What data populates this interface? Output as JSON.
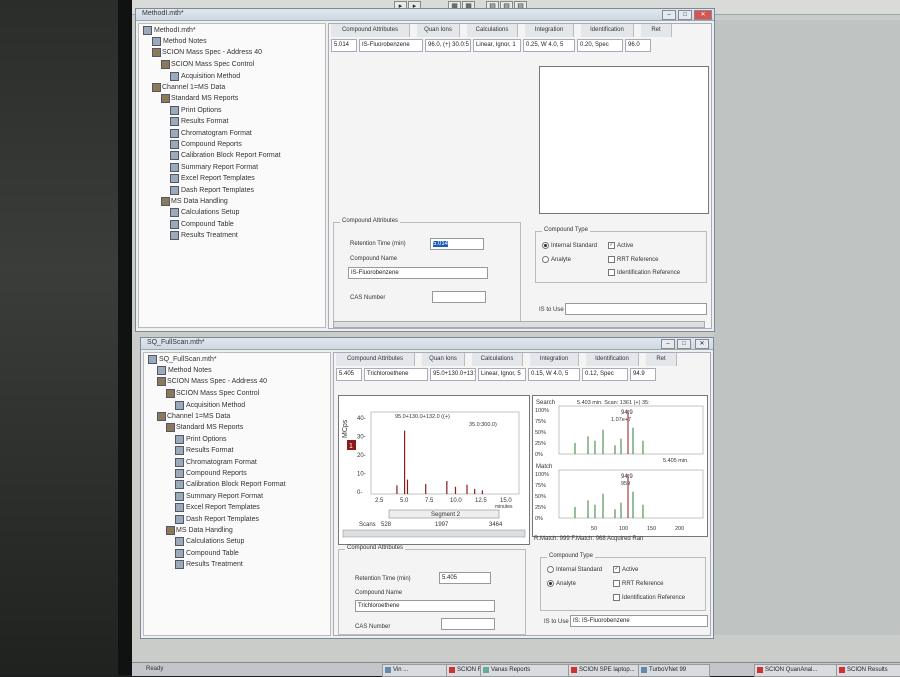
{
  "colors": {
    "accent": "#1a5fb4",
    "close": "#d9534f",
    "series_red": "#8b1a1a",
    "series_green": "#2e7d32"
  },
  "window1": {
    "title": "MethodI.mth*",
    "tree": [
      {
        "label": "MethodI.mth*",
        "level": 0,
        "exp": "",
        "icon": "doc"
      },
      {
        "label": "Method Notes",
        "level": 1,
        "exp": "",
        "icon": "doc"
      },
      {
        "label": "SCION Mass Spec - Address 40",
        "level": 1,
        "exp": "⊟",
        "icon": "grp"
      },
      {
        "label": "SCION Mass Spec Control",
        "level": 2,
        "exp": "⊟",
        "icon": "grp"
      },
      {
        "label": "Acquisition Method",
        "level": 3,
        "exp": "",
        "icon": "doc"
      },
      {
        "label": "Channel 1=MS Data",
        "level": 1,
        "exp": "⊟",
        "icon": "grp"
      },
      {
        "label": "Standard MS Reports",
        "level": 2,
        "exp": "⊟",
        "icon": "grp"
      },
      {
        "label": "Print Options",
        "level": 3,
        "exp": "",
        "icon": "doc"
      },
      {
        "label": "Results Format",
        "level": 3,
        "exp": "",
        "icon": "doc"
      },
      {
        "label": "Chromatogram Format",
        "level": 3,
        "exp": "",
        "icon": "doc"
      },
      {
        "label": "Compound Reports",
        "level": 3,
        "exp": "",
        "icon": "doc"
      },
      {
        "label": "Calibration Block Report Format",
        "level": 3,
        "exp": "",
        "icon": "doc"
      },
      {
        "label": "Summary Report Format",
        "level": 3,
        "exp": "",
        "icon": "doc"
      },
      {
        "label": "Excel Report Templates",
        "level": 3,
        "exp": "",
        "icon": "doc"
      },
      {
        "label": "Dash Report Templates",
        "level": 3,
        "exp": "",
        "icon": "doc"
      },
      {
        "label": "MS Data Handling",
        "level": 2,
        "exp": "⊟",
        "icon": "grp"
      },
      {
        "label": "Calculations Setup",
        "level": 3,
        "exp": "",
        "icon": "doc"
      },
      {
        "label": "Compound Table",
        "level": 3,
        "exp": "",
        "icon": "doc"
      },
      {
        "label": "Results Treatment",
        "level": 3,
        "exp": "",
        "icon": "doc"
      }
    ],
    "tabs": [
      "Compound Attributes",
      "Quan Ions",
      "Calculations",
      "Integration",
      "Identification",
      "Ret"
    ],
    "row": [
      "5.014",
      "IS-Fluorobenzene",
      "96.0, (+) 30.0:5",
      "Linear, Ignor, 1",
      "0.25, W 4.0, 5",
      "0.20, Spec",
      "96.0"
    ],
    "attributes": {
      "group_title": "Compound Attributes",
      "retention_label": "Retention Time (min)",
      "retention_value": "5.014",
      "name_label": "Compound Name",
      "name_value": "IS-Fluorobenzene",
      "cas_label": "CAS Number",
      "cas_value": ""
    },
    "compound_type": {
      "title": "Compound Type",
      "internal_standard": "Internal Standard",
      "analyte": "Analyte",
      "active": "Active",
      "rrt": "RRT Reference",
      "identification": "Identification Reference",
      "is_to_use": "IS to Use",
      "is_value": ""
    }
  },
  "window2": {
    "title": "SQ_FullScan.mth*",
    "tree": [
      {
        "label": "SQ_FullScan.mth*",
        "level": 0,
        "exp": "",
        "icon": "doc"
      },
      {
        "label": "Method Notes",
        "level": 1,
        "exp": "",
        "icon": "doc"
      },
      {
        "label": "SCION Mass Spec - Address 40",
        "level": 1,
        "exp": "⊟",
        "icon": "grp"
      },
      {
        "label": "SCION Mass Spec Control",
        "level": 2,
        "exp": "⊟",
        "icon": "grp"
      },
      {
        "label": "Acquisition Method",
        "level": 3,
        "exp": "",
        "icon": "doc"
      },
      {
        "label": "Channel 1=MS Data",
        "level": 1,
        "exp": "⊟",
        "icon": "grp"
      },
      {
        "label": "Standard MS Reports",
        "level": 2,
        "exp": "⊟",
        "icon": "grp"
      },
      {
        "label": "Print Options",
        "level": 3,
        "exp": "",
        "icon": "doc"
      },
      {
        "label": "Results Format",
        "level": 3,
        "exp": "",
        "icon": "doc"
      },
      {
        "label": "Chromatogram Format",
        "level": 3,
        "exp": "",
        "icon": "doc"
      },
      {
        "label": "Compound Reports",
        "level": 3,
        "exp": "",
        "icon": "doc"
      },
      {
        "label": "Calibration Block Report Format",
        "level": 3,
        "exp": "",
        "icon": "doc"
      },
      {
        "label": "Summary Report Format",
        "level": 3,
        "exp": "",
        "icon": "doc"
      },
      {
        "label": "Excel Report Templates",
        "level": 3,
        "exp": "",
        "icon": "doc"
      },
      {
        "label": "Dash Report Templates",
        "level": 3,
        "exp": "",
        "icon": "doc"
      },
      {
        "label": "MS Data Handling",
        "level": 2,
        "exp": "⊟",
        "icon": "grp"
      },
      {
        "label": "Calculations Setup",
        "level": 3,
        "exp": "",
        "icon": "doc"
      },
      {
        "label": "Compound Table",
        "level": 3,
        "exp": "",
        "icon": "doc"
      },
      {
        "label": "Results Treatment",
        "level": 3,
        "exp": "",
        "icon": "doc"
      }
    ],
    "tabs": [
      "Compound Attributes",
      "Quan Ions",
      "Calculations",
      "Integration",
      "Identification",
      "Ret"
    ],
    "row": [
      "5.405",
      "Trichloroethene",
      "95.0+130.0+13:",
      "Linear, Ignor, 5",
      "0.15, W 4.0, 5",
      "0.12, Spec",
      "94.9"
    ],
    "chromatogram": {
      "ylabel": "MCps",
      "yticks": [
        "40-",
        "30-",
        "20-",
        "10-",
        "0-"
      ],
      "xticks": [
        "2.5",
        "5.0",
        "7.5",
        "10.0",
        "12.5",
        "15.0"
      ],
      "xunit": "minutes",
      "annot1": "95.0+130.0+132.0 ((+)",
      "annot2": "35.0:300.0)",
      "segment": "Segment 2",
      "scans_label": "Scans",
      "scans": [
        "528",
        "1997",
        "3464"
      ],
      "marker": "1",
      "peaks": [
        [
          4.2,
          0.12
        ],
        [
          5.0,
          0.88
        ],
        [
          5.3,
          0.2
        ],
        [
          7.2,
          0.14
        ],
        [
          9.4,
          0.18
        ],
        [
          10.3,
          0.1
        ],
        [
          11.5,
          0.13
        ],
        [
          12.3,
          0.07
        ],
        [
          13.1,
          0.05
        ]
      ]
    },
    "spectrum": {
      "search_label": "Search",
      "search_header": "5.403 min. Scan: 1361 (+) 35:",
      "match_label": "Match",
      "match_footer": "5.405 min.",
      "yticks": [
        "100%",
        "75%",
        "50%",
        "25%",
        "0%"
      ],
      "search_annot": "94.9",
      "search_annot2": "1.07e+7",
      "match_annot": "94.9",
      "match_annot2": "959",
      "xticks": [
        "50",
        "100",
        "150",
        "200"
      ],
      "footer": "R.Match: 999  F.Match: 968  Acquired Ran"
    },
    "attributes": {
      "group_title": "Compound Attributes",
      "retention_label": "Retention Time (min)",
      "retention_value": "5.405",
      "name_label": "Compound Name",
      "name_value": "Trichloroethene",
      "cas_label": "CAS Number",
      "cas_value": ""
    },
    "compound_type": {
      "title": "Compound Type",
      "internal_standard": "Internal Standard",
      "analyte": "Analyte",
      "active": "Active",
      "rrt": "RRT Reference",
      "identification": "Identification Reference",
      "is_to_use": "IS to Use",
      "is_value": "IS: IS-Fluorobenzene"
    }
  },
  "statusbar": {
    "text": "Ready"
  },
  "taskbar": [
    "Vin ...",
    "SCION Run Results",
    "Vanas Reports",
    "SCION SPE laptop...",
    "TurboVNet 99",
    "SCION QuanAnal...",
    "SCION Results"
  ]
}
